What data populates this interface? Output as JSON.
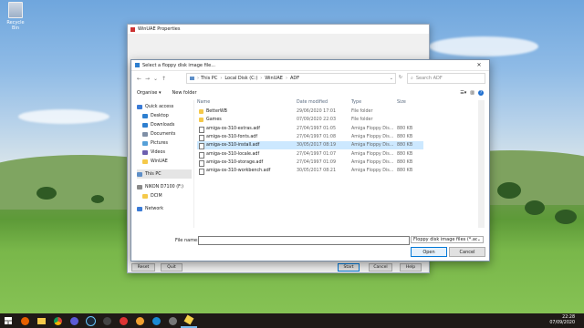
{
  "desktop": {
    "recycle_label": "Recycle Bin"
  },
  "winuae": {
    "title": "WinUAE Properties",
    "buttons": {
      "reset": "Reset",
      "quit": "Quit",
      "start": "Start",
      "cancel": "Cancel",
      "help": "Help"
    }
  },
  "dialog": {
    "title": "Select a floppy disk image file...",
    "breadcrumb": [
      "This PC",
      "Local Disk (C:)",
      "WinUAE",
      "ADF"
    ],
    "search_placeholder": "Search ADF",
    "organize_label": "Organise",
    "new_folder_label": "New folder",
    "nav": [
      {
        "label": "Quick access",
        "icon": "star-icon",
        "color": "#3b7bd6"
      },
      {
        "label": "Desktop",
        "icon": "desktop-icon",
        "color": "#2d7fd0"
      },
      {
        "label": "Downloads",
        "icon": "download-icon",
        "color": "#2d7fd0"
      },
      {
        "label": "Documents",
        "icon": "document-icon",
        "color": "#7f8fa6"
      },
      {
        "label": "Pictures",
        "icon": "pictures-icon",
        "color": "#56a0d8"
      },
      {
        "label": "Videos",
        "icon": "video-icon",
        "color": "#6c5fb0"
      },
      {
        "label": "WinUAE",
        "icon": "folder-icon",
        "color": "#f5c94a"
      },
      {
        "label": "This PC",
        "icon": "computer-icon",
        "color": "#5e8fc8"
      },
      {
        "label": "NIKON D7100 (F:)",
        "icon": "drive-icon",
        "color": "#8a8a8a"
      },
      {
        "label": "DCIM",
        "icon": "folder-icon",
        "color": "#f5c94a"
      },
      {
        "label": "Network",
        "icon": "network-icon",
        "color": "#3b7bd6"
      }
    ],
    "columns": {
      "name": "Name",
      "date": "Date modified",
      "type": "Type",
      "size": "Size"
    },
    "files": [
      {
        "name": "BetterWB",
        "date": "29/06/2020 17:01",
        "type": "File folder",
        "size": "",
        "icon": "folder"
      },
      {
        "name": "Games",
        "date": "07/09/2020 22:03",
        "type": "File folder",
        "size": "",
        "icon": "folder"
      },
      {
        "name": "amiga-os-310-extras.adf",
        "date": "27/04/1997 01:05",
        "type": "Amiga Floppy Dis...",
        "size": "880 KB",
        "icon": "adf"
      },
      {
        "name": "amiga-os-310-fonts.adf",
        "date": "27/04/1997 01:08",
        "type": "Amiga Floppy Dis...",
        "size": "880 KB",
        "icon": "adf"
      },
      {
        "name": "amiga-os-310-install.adf",
        "date": "30/05/2017 08:19",
        "type": "Amiga Floppy Dis...",
        "size": "880 KB",
        "icon": "adf"
      },
      {
        "name": "amiga-os-310-locale.adf",
        "date": "27/04/1997 01:07",
        "type": "Amiga Floppy Dis...",
        "size": "880 KB",
        "icon": "adf"
      },
      {
        "name": "amiga-os-310-storage.adf",
        "date": "27/04/1997 01:09",
        "type": "Amiga Floppy Dis...",
        "size": "880 KB",
        "icon": "adf"
      },
      {
        "name": "amiga-os-310-workbench.adf",
        "date": "30/05/2017 08:21",
        "type": "Amiga Floppy Dis...",
        "size": "880 KB",
        "icon": "adf"
      }
    ],
    "file_name_label": "File name:",
    "file_name_value": "",
    "filter_label": "Floppy disk image files (*.adf;*.",
    "open_label": "Open",
    "cancel_label": "Cancel"
  },
  "taskbar": {
    "time": "22:28",
    "date": "07/09/2020"
  }
}
